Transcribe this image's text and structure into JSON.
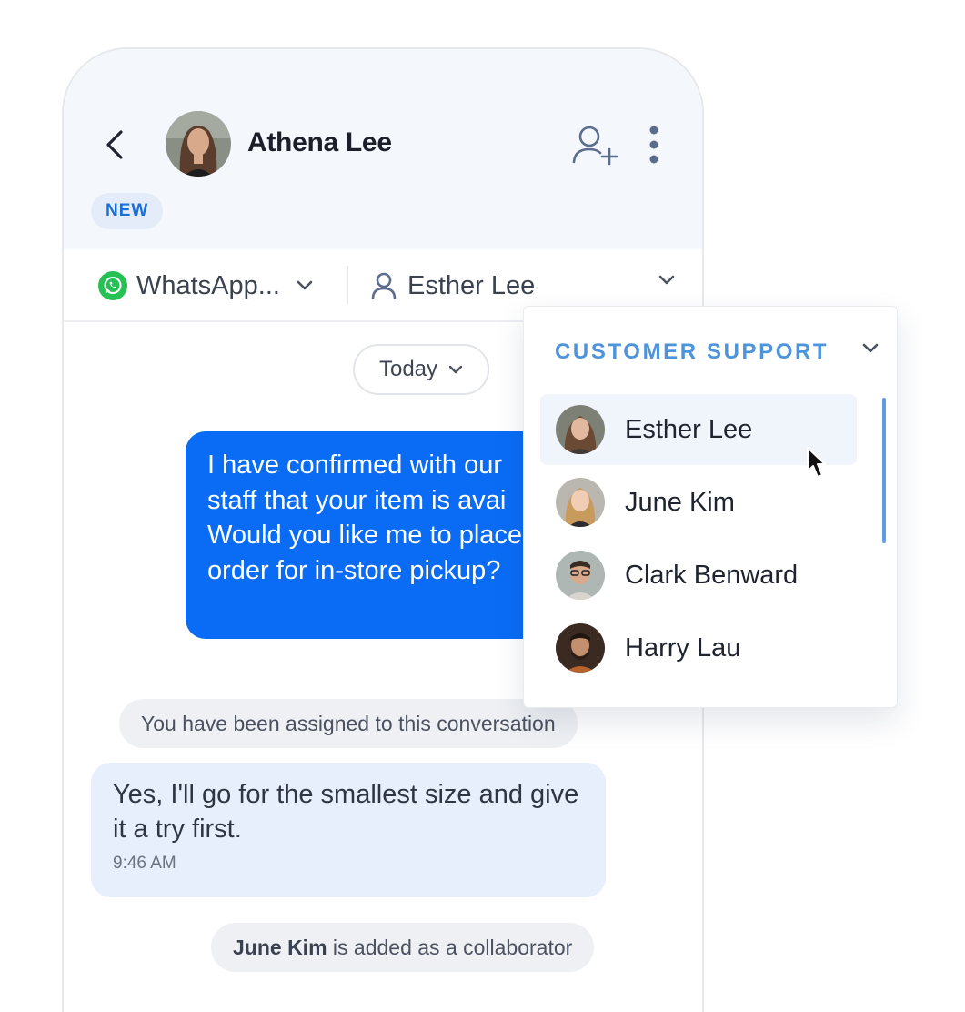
{
  "conversation": {
    "contact_name": "Athena Lee",
    "status_badge": "NEW",
    "channel_label": "WhatsApp...",
    "assignee_label": "Esther Lee",
    "date_filter_label": "Today"
  },
  "messages": {
    "outgoing_text": "I have confirmed with our\nstaff that your item is avai\nWould you like me to place\norder for in-store pickup?",
    "system_assigned": "You have been assigned to this conversation",
    "incoming_text": "Yes, I'll go for the smallest size and give it a try first.",
    "incoming_time": "9:46 AM",
    "system_collab_name": "June Kim",
    "system_collab_rest": " is added as a collaborator"
  },
  "assignee_dropdown": {
    "group_title": "CUSTOMER SUPPORT",
    "items": [
      {
        "name": "Esther Lee",
        "selected": true
      },
      {
        "name": "June Kim",
        "selected": false
      },
      {
        "name": "Clark Benward",
        "selected": false
      },
      {
        "name": "Harry Lau",
        "selected": false
      }
    ]
  },
  "colors": {
    "accent_blue": "#0a6cf5",
    "group_title": "#4d94db",
    "whatsapp_green": "#25c153",
    "badge_bg": "#e3ecf8"
  },
  "icons": {
    "back": "chevron-left-icon",
    "add_user": "user-plus-icon",
    "more": "more-vertical-icon",
    "channel": "whatsapp-icon",
    "assignee": "user-icon",
    "dropdown": "chevron-down-icon"
  }
}
